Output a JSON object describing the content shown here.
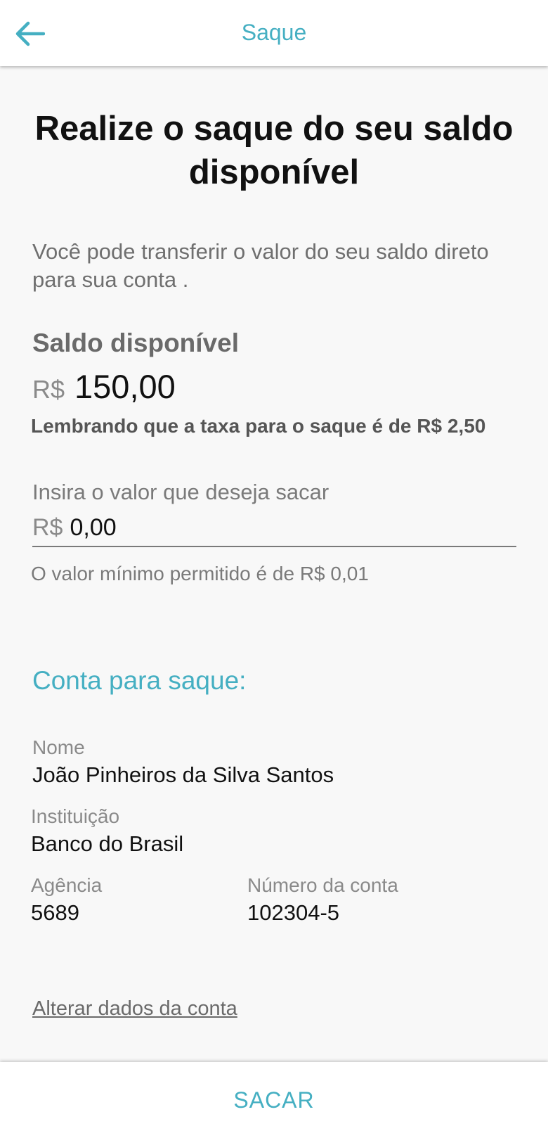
{
  "header": {
    "title": "Saque",
    "back_icon": "arrow-left-icon",
    "accent_color": "#45afc2"
  },
  "main": {
    "headline": "Realize o saque do seu saldo disponível",
    "description": "Você pode transferir o valor do seu saldo direto para sua conta .",
    "balance": {
      "label": "Saldo disponível",
      "currency": "R$",
      "value": "150,00"
    },
    "fee_note": "Lembrando que a taxa para o saque é de R$ 2,50",
    "amount_input": {
      "label": "Insira o valor que deseja sacar",
      "currency": "R$",
      "value": "0,00",
      "helper": "O valor mínimo permitido é de R$ 0,01"
    }
  },
  "account": {
    "section_title": "Conta para saque:",
    "name_label": "Nome",
    "name_value": "João Pinheiros da Silva Santos",
    "institution_label": "Instituição",
    "institution_value": "Banco do Brasil",
    "agency_label": "Agência",
    "agency_value": "5689",
    "account_number_label": "Número da conta",
    "account_number_value": "102304-5",
    "change_link": "Alterar dados da conta"
  },
  "footer": {
    "submit_label": "SACAR"
  }
}
